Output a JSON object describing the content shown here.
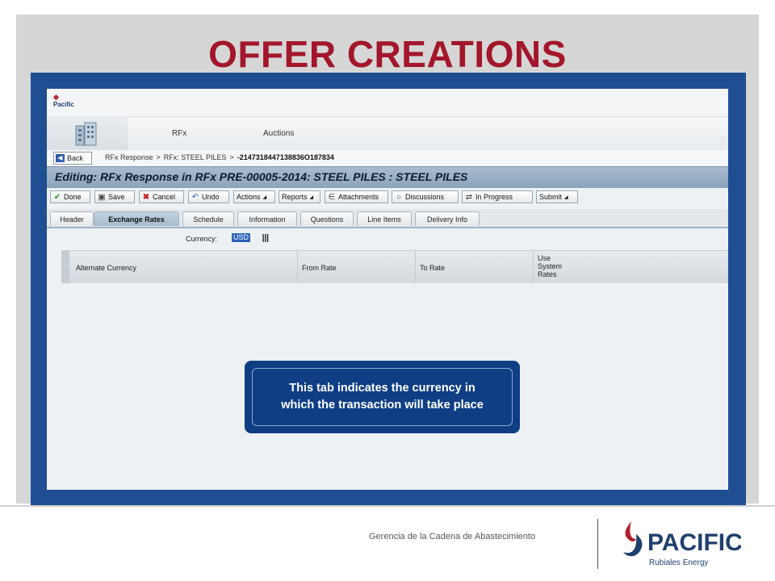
{
  "slide": {
    "title": "OFFER CREATIONS",
    "footer_text": "Gerencia de la Cadena de Abastecimiento",
    "brand": {
      "name": "PACIFIC",
      "tagline": "Rubiales Energy",
      "red": "#a3162b",
      "navy": "#1f3f6e"
    }
  },
  "app": {
    "logo_text": "Pacific",
    "nav": {
      "tabs": [
        "RFx",
        "Auctions"
      ]
    },
    "breadcrumb": {
      "back_label": "Back",
      "items": [
        "RFx Response",
        "RFx: STEEL PILES",
        "-2147318447138836O187834"
      ],
      "separator": ">"
    },
    "page_title": "Editing: RFx Response in RFx PRE-00005-2014: STEEL PILES : STEEL PILES",
    "toolbar": {
      "done": "Done",
      "save": "Save",
      "cancel": "Cancel",
      "undo": "Undo",
      "actions": "Actions",
      "reports": "Reports",
      "attachments": "Attachments",
      "discussions": "Discussions",
      "in_progress": "In Progress",
      "submit": "Submit"
    },
    "subtabs": [
      "Header",
      "Exchange Rates",
      "Schedule",
      "Information",
      "Questions",
      "Line Items",
      "Delivery Info"
    ],
    "active_subtab": "Exchange Rates",
    "currency": {
      "label": "Currency:",
      "value": "USD"
    },
    "table": {
      "columns": [
        "Alternate Currency",
        "From Rate",
        "To Rate"
      ],
      "use_system_rates": [
        "Use",
        "System",
        "Rates"
      ]
    }
  },
  "callout": {
    "line1": "This tab indicates the currency in",
    "line2": "which the transaction will take place"
  },
  "colors": {
    "frame_blue": "#1f4e93",
    "callout_blue": "#0f3e84",
    "title_red": "#a3162b"
  }
}
